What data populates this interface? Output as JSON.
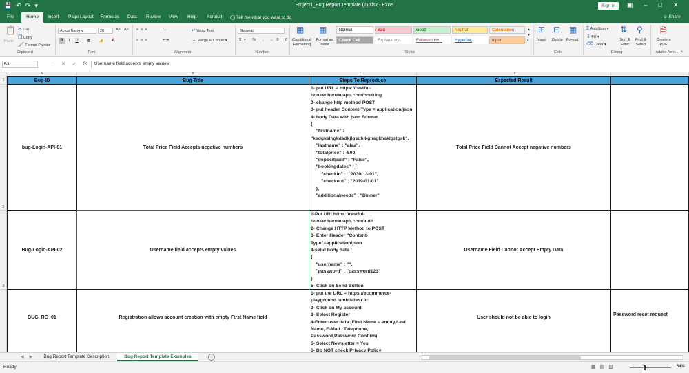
{
  "app": {
    "title": "Project1_Bug Report Template (2).xlsx  -  Excel",
    "sign_in": "Sign in",
    "share": "Share",
    "tell_me": "Tell me what you want to do"
  },
  "tabs": [
    {
      "label": "File",
      "active": false
    },
    {
      "label": "Home",
      "active": true
    },
    {
      "label": "Insert",
      "active": false
    },
    {
      "label": "Page Layout",
      "active": false
    },
    {
      "label": "Formulas",
      "active": false
    },
    {
      "label": "Data",
      "active": false
    },
    {
      "label": "Review",
      "active": false
    },
    {
      "label": "View",
      "active": false
    },
    {
      "label": "Help",
      "active": false
    },
    {
      "label": "Acrobat",
      "active": false
    }
  ],
  "ribbon": {
    "clipboard": {
      "label": "Clipboard",
      "paste": "Paste",
      "cut": "Cut",
      "copy": "Copy",
      "format_painter": "Format Painter"
    },
    "font": {
      "label": "Font",
      "font_name": "Aptos Narrow",
      "font_size": "20"
    },
    "alignment": {
      "label": "Alignment",
      "wrap_text": "Wrap Text",
      "merge_center": "Merge & Center"
    },
    "number": {
      "label": "Number",
      "format": "General"
    },
    "styles": {
      "label": "Styles",
      "conditional_formatting": "Conditional Formatting",
      "format_as_table": "Format as Table",
      "cells": [
        {
          "label": "Normal",
          "bg": "#ffffff",
          "fg": "#000000"
        },
        {
          "label": "Bad",
          "bg": "#ffc7ce",
          "fg": "#9c0006"
        },
        {
          "label": "Good",
          "bg": "#c6efce",
          "fg": "#006100"
        },
        {
          "label": "Neutral",
          "bg": "#ffeb9c",
          "fg": "#9c5700"
        },
        {
          "label": "Calculation",
          "bg": "#f2f2f2",
          "fg": "#fa7d00"
        },
        {
          "label": "Check Cell",
          "bg": "#a5a5a5",
          "fg": "#ffffff"
        },
        {
          "label": "Explanatory...",
          "bg": "#ffffff",
          "fg": "#7f7f7f"
        },
        {
          "label": "Followed Hy...",
          "bg": "#ffffff",
          "fg": "#954f72"
        },
        {
          "label": "Hyperlink",
          "bg": "#ffffff",
          "fg": "#0563c1"
        },
        {
          "label": "Input",
          "bg": "#ffcc99",
          "fg": "#3f3f76"
        }
      ]
    },
    "cells": {
      "label": "Cells",
      "insert": "Insert",
      "delete": "Delete",
      "format": "Format"
    },
    "editing": {
      "label": "Editing",
      "autosum": "AutoSum",
      "fill": "Fill",
      "clear": "Clear",
      "sort_filter": "Sort & Filter",
      "find_select": "Find & Select"
    },
    "acrobat": {
      "label": "Adobe Acro...",
      "create_pdf": "Create a PDF"
    }
  },
  "formula_bar": {
    "name_box": "B3",
    "content": "Username field accepts empty values"
  },
  "columns": [
    {
      "letter": "A",
      "header": "Bug ID"
    },
    {
      "letter": "B",
      "header": "Bug Title"
    },
    {
      "letter": "C",
      "header": "Steps To Reproduce"
    },
    {
      "letter": "D",
      "header": "Expected Result"
    },
    {
      "letter": "",
      "header": ""
    }
  ],
  "row_numbers": [
    "1",
    "2",
    "3",
    ""
  ],
  "rows": [
    {
      "bug_id": "bug-Login-API-01",
      "bug_title": "Total Price Field Accepts negative numbers",
      "steps": "1- put URL = https://restful-booker.herokuapp.com/booking\n2- change http method POST\n3- put header Content-Type = application/json\n4- body Data with json Format\n{\n    \"firstname\" : \"ksdgkslhgkdsdkjlgsdhlkghsgkhsklgslgsk\",\n    \"lastname\" : \"alaa\",\n    \"totalprice\" : -500,\n    \"depositpaid\" : \"False\",\n    \"bookingdates\" : {\n        \"checkin\" :  \"2030-13-01\",\n        \"checkout\" : \"2019-01-01\"\n    },\n    \"additionalneeds\" : \"Dinner\"",
      "expected": "Total Price Field Cannot Accept negative numbers",
      "extra": ""
    },
    {
      "bug_id": "Bug-Login-API-02",
      "bug_title": "Username field accepts empty values",
      "steps": "1-Put URLhttps://restful-booker.herokuapp.com/auth\n2- Change HTTP Method to POST\n3- Enter Header \"Content-Type\"=application/json\n4-send body data :\n{\n    \"username\" : \"\",\n    \"password\" : \"password123\"\n}\n5- Click on Send Button",
      "expected": "Username Field Cannot Accept Empty Data",
      "extra": ""
    },
    {
      "bug_id": "BUG_RG_01",
      "bug_title": "Registration allows account creation with empty First Name field",
      "steps": "1- put the URL = https://ecommerce-playground.lambdatest.io\n2- Click on My account\n3- Select Register\n4-Enter user data (First Name = empty,Last Name, E-Mail , Telephone, Password,Password Confirm)\n5- Select Newsletter = Yes\n6- Do NOT check Privacy Policy",
      "expected": "User should not be able to login",
      "extra": "Password reset request"
    }
  ],
  "sheets": [
    {
      "label": "Bug Report Template Description",
      "active": false
    },
    {
      "label": "Bug Report Template Examples",
      "active": true
    }
  ],
  "status": {
    "ready": "Ready",
    "zoom": "64%"
  }
}
